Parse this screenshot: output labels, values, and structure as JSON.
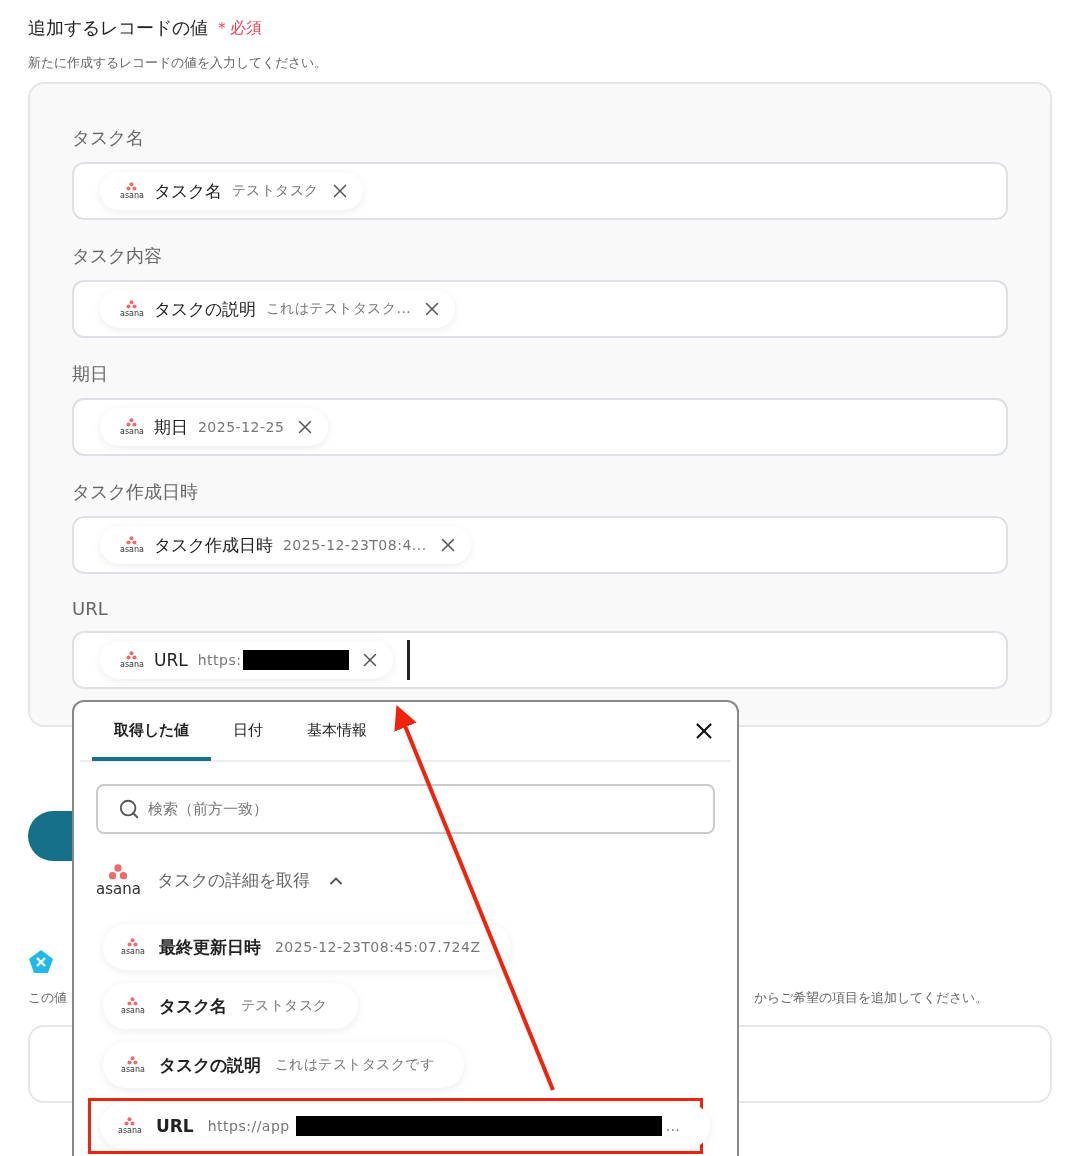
{
  "section": {
    "title": "追加するレコードの値",
    "required_mark": "＊",
    "required_label": "必須",
    "description": "新たに作成するレコードの値を入力してください。"
  },
  "fields": [
    {
      "label": "タスク名",
      "cursor": false,
      "chips": [
        {
          "source": "asana",
          "name": "タスク名",
          "value": "テストタスク",
          "redacted": false
        }
      ]
    },
    {
      "label": "タスク内容",
      "cursor": false,
      "chips": [
        {
          "source": "asana",
          "name": "タスクの説明",
          "value": "これはテストタスク...",
          "redacted": false
        }
      ]
    },
    {
      "label": "期日",
      "cursor": false,
      "chips": [
        {
          "source": "asana",
          "name": "期日",
          "value": "2025-12-25",
          "redacted": false
        }
      ]
    },
    {
      "label": "タスク作成日時",
      "cursor": false,
      "chips": [
        {
          "source": "asana",
          "name": "タスク作成日時",
          "value": "2025-12-23T08:4...",
          "redacted": false
        }
      ]
    },
    {
      "label": "URL",
      "cursor": true,
      "chips": [
        {
          "source": "asana",
          "name": "URL",
          "value": "https:",
          "redacted": true
        }
      ]
    }
  ],
  "next_section": {
    "description_start": "この値",
    "description_end": "からご希望の項目を追加してください。"
  },
  "popup": {
    "tabs": [
      {
        "label": "取得した値",
        "selected": true
      },
      {
        "label": "日付",
        "selected": false
      },
      {
        "label": "基本情報",
        "selected": false
      }
    ],
    "search": {
      "placeholder": "検索（前方一致）"
    },
    "group": {
      "source": "asana",
      "title": "タスクの詳細を取得",
      "expanded": true,
      "items": [
        {
          "source": "asana",
          "name": "最終更新日時",
          "value": "2025-12-23T08:45:07.724Z",
          "redacted": false,
          "highlighted": false
        },
        {
          "source": "asana",
          "name": "タスク名",
          "value": "テストタスク",
          "redacted": false,
          "highlighted": false
        },
        {
          "source": "asana",
          "name": "タスクの説明",
          "value": "これはテストタスクです",
          "redacted": false,
          "highlighted": false
        },
        {
          "source": "asana",
          "name": "URL",
          "value": "https://app",
          "value_tail": "…",
          "redacted": true,
          "highlighted": true
        }
      ]
    }
  }
}
